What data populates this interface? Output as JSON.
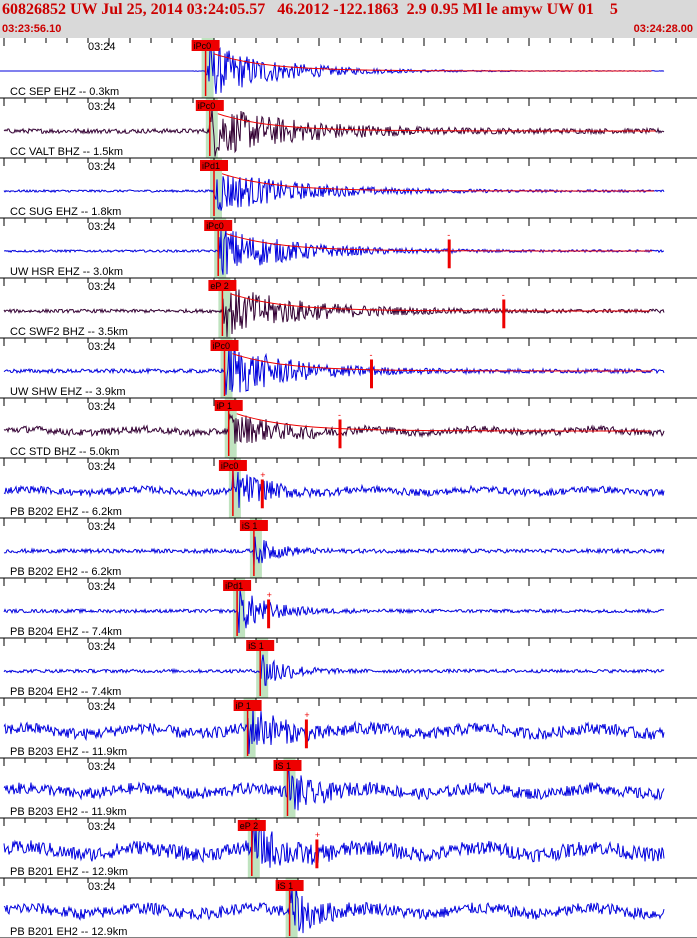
{
  "header": {
    "title": "60826852 UW Jul 25, 2014 03:24:05.57   46.2012 -122.1863  2.9 0.95 Ml le amyw UW 01    5",
    "start_time": "03:23:56.10",
    "end_time": "03:24:28.00"
  },
  "colors": {
    "header_bg": "#d9d9d9",
    "header_text": "#cc0000",
    "trace_blue": "#0000dd",
    "trace_dark": "#330033",
    "pick": "#ee0000",
    "window": "#bfe3bf"
  },
  "chart_data": {
    "type": "line",
    "title": "60826852 UW Jul 25, 2014 03:24:05.57   46.2012 -122.1863  2.9 0.95 Ml le amyw UW 01    5",
    "x_range": [
      "03:23:56.10",
      "03:24:28.00"
    ],
    "time_label": "03:24",
    "grid": true,
    "series": [
      {
        "name": "CC SEP EHZ -- 0.3km",
        "pick": "iPc0",
        "pick_s": 9.6,
        "amp": 1.0,
        "color": "#0000dd",
        "noise": 0.01,
        "flat_until": 9.0,
        "extra": [],
        "coda": 18
      },
      {
        "name": "CC VALT BHZ -- 1.5km",
        "pick": "iPc0",
        "pick_s": 9.8,
        "amp": 0.9,
        "color": "#330033",
        "noise": 0.08,
        "flat_until": 0,
        "extra": [],
        "coda": 22
      },
      {
        "name": "CC SUG EHZ -- 1.8km",
        "pick": "iPd1",
        "pick_s": 10.0,
        "amp": 0.8,
        "color": "#0000dd",
        "noise": 0.04,
        "flat_until": 0,
        "extra": [],
        "coda": 20
      },
      {
        "name": "UW HSR EHZ -- 3.0km",
        "pick": "iPc0",
        "pick_s": 10.2,
        "amp": 0.9,
        "color": "#0000dd",
        "noise": 0.04,
        "flat_until": 0,
        "extra": [
          {
            "s": 21.2,
            "label": "-"
          }
        ],
        "coda": 18
      },
      {
        "name": "CC SWF2 BHZ -- 3.5km",
        "pick": "eP 2",
        "pick_s": 10.4,
        "amp": 0.9,
        "color": "#330033",
        "noise": 0.06,
        "flat_until": 0,
        "extra": [
          {
            "s": 23.8,
            "label": "-"
          }
        ],
        "coda": 20
      },
      {
        "name": "UW SHW EHZ -- 3.9km",
        "pick": "iPc0",
        "pick_s": 10.5,
        "amp": 1.0,
        "color": "#0000dd",
        "noise": 0.07,
        "flat_until": 0,
        "extra": [
          {
            "s": 17.5,
            "label": "-"
          }
        ],
        "coda": 16
      },
      {
        "name": "CC STD BHZ -- 5.0km",
        "pick": "iP 1",
        "pick_s": 10.7,
        "amp": 0.6,
        "color": "#330033",
        "noise": 0.12,
        "flat_until": 0,
        "extra": [
          {
            "s": 16.0,
            "label": "-"
          }
        ],
        "coda": 12
      },
      {
        "name": "PB B202 EHZ -- 6.2km",
        "pick": "iPc0",
        "pick_s": 10.9,
        "amp": 0.7,
        "color": "#0000dd",
        "noise": 0.12,
        "flat_until": 0,
        "extra": [
          {
            "s": 12.3,
            "label": "+"
          }
        ],
        "coda": 8
      },
      {
        "name": "PB B202 EH2 -- 6.2km",
        "pick": "iS 1",
        "pick_s": 11.9,
        "amp": 0.5,
        "color": "#0000dd",
        "noise": 0.07,
        "flat_until": 0,
        "extra": [],
        "coda": 6
      },
      {
        "name": "PB B204 EHZ -- 7.4km",
        "pick": "iPd1",
        "pick_s": 11.1,
        "amp": 0.8,
        "color": "#0000dd",
        "noise": 0.06,
        "flat_until": 0,
        "extra": [
          {
            "s": 12.6,
            "label": "+"
          }
        ],
        "coda": 8
      },
      {
        "name": "PB B204 EH2 -- 7.4km",
        "pick": "iS 1",
        "pick_s": 12.2,
        "amp": 0.8,
        "color": "#0000dd",
        "noise": 0.06,
        "flat_until": 0,
        "extra": [],
        "coda": 6
      },
      {
        "name": "PB B203 EHZ -- 11.9km",
        "pick": "iP 1",
        "pick_s": 11.6,
        "amp": 0.8,
        "color": "#0000dd",
        "noise": 0.2,
        "flat_until": 0,
        "extra": [
          {
            "s": 14.4,
            "label": "+"
          }
        ],
        "coda": 8
      },
      {
        "name": "PB B203 EH2 -- 11.9km",
        "pick": "iS 1",
        "pick_s": 13.5,
        "amp": 0.8,
        "color": "#0000dd",
        "noise": 0.2,
        "flat_until": 0,
        "extra": [],
        "coda": 6
      },
      {
        "name": "PB B201 EHZ -- 12.9km",
        "pick": "eP 2",
        "pick_s": 11.8,
        "amp": 0.8,
        "color": "#0000dd",
        "noise": 0.25,
        "flat_until": 0,
        "extra": [
          {
            "s": 14.9,
            "label": "+"
          }
        ],
        "coda": 8
      },
      {
        "name": "PB B201 EH2 -- 12.9km",
        "pick": "iS 1",
        "pick_s": 13.6,
        "amp": 0.9,
        "color": "#0000dd",
        "noise": 0.2,
        "flat_until": 0,
        "extra": [],
        "coda": 6
      }
    ]
  }
}
